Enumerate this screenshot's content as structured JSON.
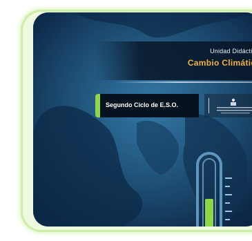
{
  "cover": {
    "subtitle": "Unidad Didáctica:",
    "title": "Cambio Climático",
    "level": "Segundo Ciclo de E.S.O."
  },
  "colors": {
    "frame_green": "#cdeea6",
    "accent_green": "#8fd64a",
    "title_orange": "#f2b33d",
    "background_blue": "#1f5a85"
  },
  "icons": {
    "emblem": "institution-emblem-icon",
    "thermometer": "thermometer-icon"
  }
}
